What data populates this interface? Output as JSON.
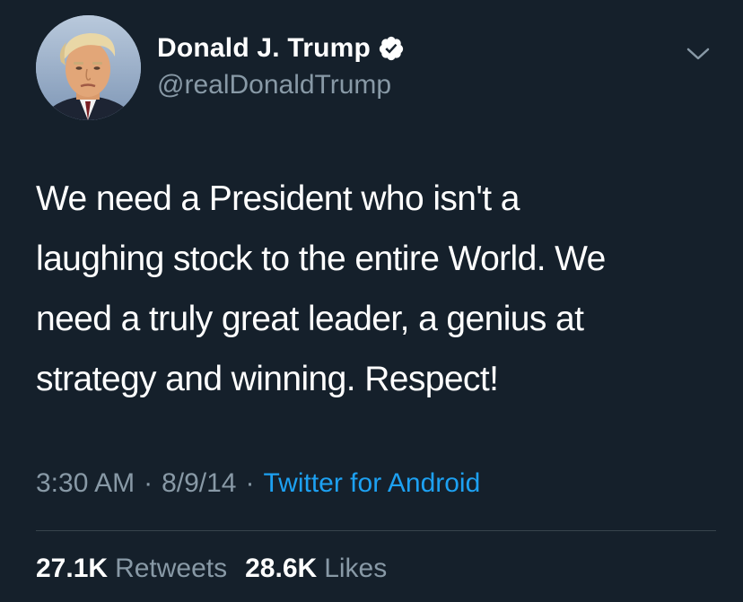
{
  "user": {
    "display_name": "Donald J. Trump",
    "handle": "@realDonaldTrump",
    "verified": true
  },
  "tweet": {
    "text": "We need a President who isn't a\nlaughing stock to the entire World. We\nneed a truly great leader, a genius at\nstrategy and winning. Respect!",
    "time": "3:30 AM",
    "date": "8/9/14",
    "separator": "·",
    "source": "Twitter for Android"
  },
  "stats": {
    "retweets_count": "27.1K",
    "retweets_label": "Retweets",
    "likes_count": "28.6K",
    "likes_label": "Likes"
  },
  "colors": {
    "background": "#15202b",
    "primary_text": "#ffffff",
    "secondary_text": "#8899a6",
    "link": "#1da1f2",
    "divider": "#38444d"
  },
  "icons": {
    "verified": "verified-badge-icon",
    "more": "chevron-down-icon"
  }
}
